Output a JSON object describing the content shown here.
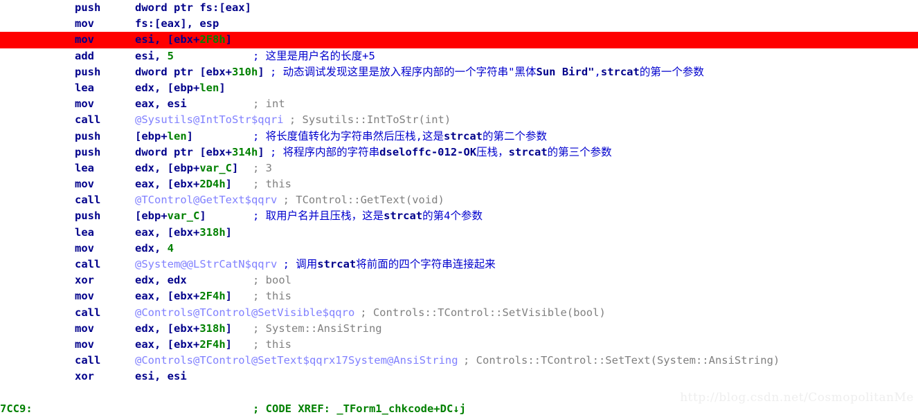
{
  "app": {
    "name": "IDA Pro disassembly view",
    "watermark": "http://blog.csdn.net/CosmopolitanMe"
  },
  "colors": {
    "background": "#ffffff",
    "mnemonic": "#00008b",
    "operand": "#00008b",
    "number": "#008000",
    "comment_english": "#808080",
    "comment_chinese": "#0000cd",
    "function_name": "#8080ff",
    "address_label": "#008000",
    "highlight_row": "#ff0000",
    "watermark": "#eeeeee"
  },
  "listing": {
    "lines": [
      {
        "mnemonic": "push",
        "operand": "dword ptr fs:[eax]",
        "comment": "",
        "highlight": false
      },
      {
        "mnemonic": "mov",
        "operand": "fs:[eax], esp",
        "comment": "",
        "highlight": false
      },
      {
        "mnemonic": "mov",
        "operand": "esi, [ebx+2F8h]",
        "comment": "",
        "highlight": true
      },
      {
        "mnemonic": "add",
        "operand": "esi, 5",
        "comment": "; 这里是用户名的长度+5",
        "highlight": false
      },
      {
        "mnemonic": "push",
        "operand": "dword ptr [ebx+310h]",
        "comment": "; 动态调试发现这里是放入程序内部的一个字符串\"黑体Sun Bird\",strcat的第一个参数",
        "highlight": false
      },
      {
        "mnemonic": "lea",
        "operand": "edx, [ebp+len]",
        "comment": "",
        "highlight": false
      },
      {
        "mnemonic": "mov",
        "operand": "eax, esi",
        "comment": "; int",
        "highlight": false
      },
      {
        "mnemonic": "call",
        "operand": "@Sysutils@IntToStr$qqri",
        "comment": "; Sysutils::IntToStr(int)",
        "highlight": false
      },
      {
        "mnemonic": "push",
        "operand": "[ebp+len]",
        "comment": "; 将长度值转化为字符串然后压栈,这是strcat的第二个参数",
        "highlight": false
      },
      {
        "mnemonic": "push",
        "operand": "dword ptr [ebx+314h]",
        "comment": "; 将程序内部的字符串dseloffc-012-OK压栈，strcat的第三个参数",
        "highlight": false
      },
      {
        "mnemonic": "lea",
        "operand": "edx, [ebp+var_C]",
        "comment": "; 3",
        "highlight": false
      },
      {
        "mnemonic": "mov",
        "operand": "eax, [ebx+2D4h]",
        "comment": "; this",
        "highlight": false
      },
      {
        "mnemonic": "call",
        "operand": "@TControl@GetText$qqrv",
        "comment": "; TControl::GetText(void)",
        "highlight": false
      },
      {
        "mnemonic": "push",
        "operand": "[ebp+var_C]",
        "comment": "; 取用户名并且压栈，这是strcat的第4个参数",
        "highlight": false
      },
      {
        "mnemonic": "lea",
        "operand": "eax, [ebx+318h]",
        "comment": "",
        "highlight": false
      },
      {
        "mnemonic": "mov",
        "operand": "edx, 4",
        "comment": "",
        "highlight": false
      },
      {
        "mnemonic": "call",
        "operand": "@System@@LStrCatN$qqrv",
        "comment": "; 调用strcat将前面的四个字符串连接起来",
        "highlight": false
      },
      {
        "mnemonic": "xor",
        "operand": "edx, edx",
        "comment": "; bool",
        "highlight": false
      },
      {
        "mnemonic": "mov",
        "operand": "eax, [ebx+2F4h]",
        "comment": "; this",
        "highlight": false
      },
      {
        "mnemonic": "call",
        "operand": "@Controls@TControl@SetVisible$qqro",
        "comment": "; Controls::TControl::SetVisible(bool)",
        "highlight": false
      },
      {
        "mnemonic": "mov",
        "operand": "edx, [ebx+318h]",
        "comment": "; System::AnsiString",
        "highlight": false
      },
      {
        "mnemonic": "mov",
        "operand": "eax, [ebx+2F4h]",
        "comment": "; this",
        "highlight": false
      },
      {
        "mnemonic": "call",
        "operand": "@Controls@TControl@SetText$qqrx17System@AnsiString",
        "comment": "; Controls::TControl::SetText(System::AnsiString)",
        "highlight": false
      },
      {
        "mnemonic": "xor",
        "operand": "esi, esi",
        "comment": "",
        "highlight": false
      }
    ],
    "address_line": {
      "address": "7CC9:",
      "xref": "; CODE XREF: _TForm1_chkcode+DC↓j"
    }
  }
}
